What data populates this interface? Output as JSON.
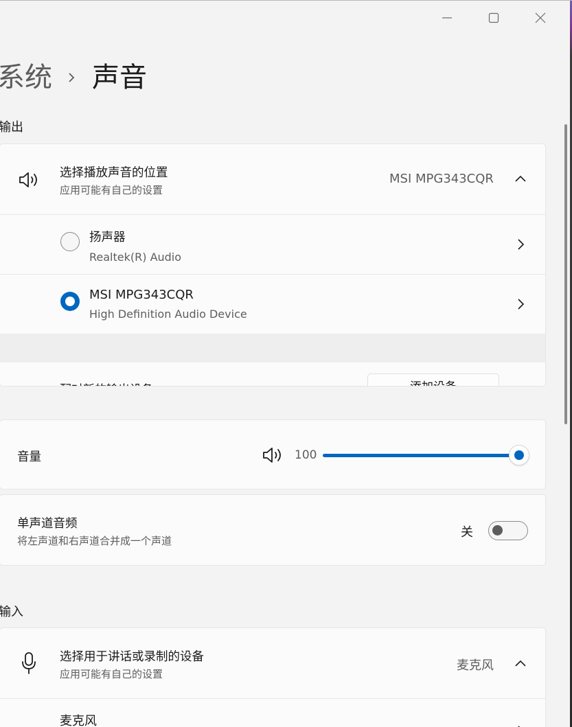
{
  "window": {
    "controls": [
      {
        "name": "minimize",
        "icon": "minimize-icon"
      },
      {
        "name": "maximize",
        "icon": "maximize-icon"
      },
      {
        "name": "close",
        "icon": "close-icon"
      }
    ]
  },
  "breadcrumb": {
    "parent": "系统",
    "current": "声音"
  },
  "output": {
    "section_label": "输出",
    "header": {
      "title": "选择播放声音的位置",
      "subtitle": "应用可能有自己的设置",
      "selected_device": "MSI MPG343CQR",
      "icon": "speaker-icon"
    },
    "devices": [
      {
        "name": "扬声器",
        "detail": "Realtek(R) Audio",
        "selected": false
      },
      {
        "name": "MSI MPG343CQR",
        "detail": "High Definition Audio Device",
        "selected": true
      }
    ],
    "pair_row": {
      "label": "配对新的输出设备",
      "button": "添加设备"
    }
  },
  "volume": {
    "label": "音量",
    "value": "100",
    "level_percent": 100,
    "icon": "speaker-icon"
  },
  "mono": {
    "title": "单声道音频",
    "subtitle": "将左声道和右声道合并成一个声道",
    "state_label": "关",
    "on": false
  },
  "input": {
    "section_label": "输入",
    "header": {
      "title": "选择用于讲话或录制的设备",
      "subtitle": "应用可能有自己的设置",
      "selected_device": "麦克风",
      "icon": "microphone-icon"
    },
    "devices": [
      {
        "name": "麦克风"
      }
    ]
  },
  "colors": {
    "accent": "#0067c0",
    "background": "#f3f3f3",
    "card": "#fbfbfb"
  }
}
